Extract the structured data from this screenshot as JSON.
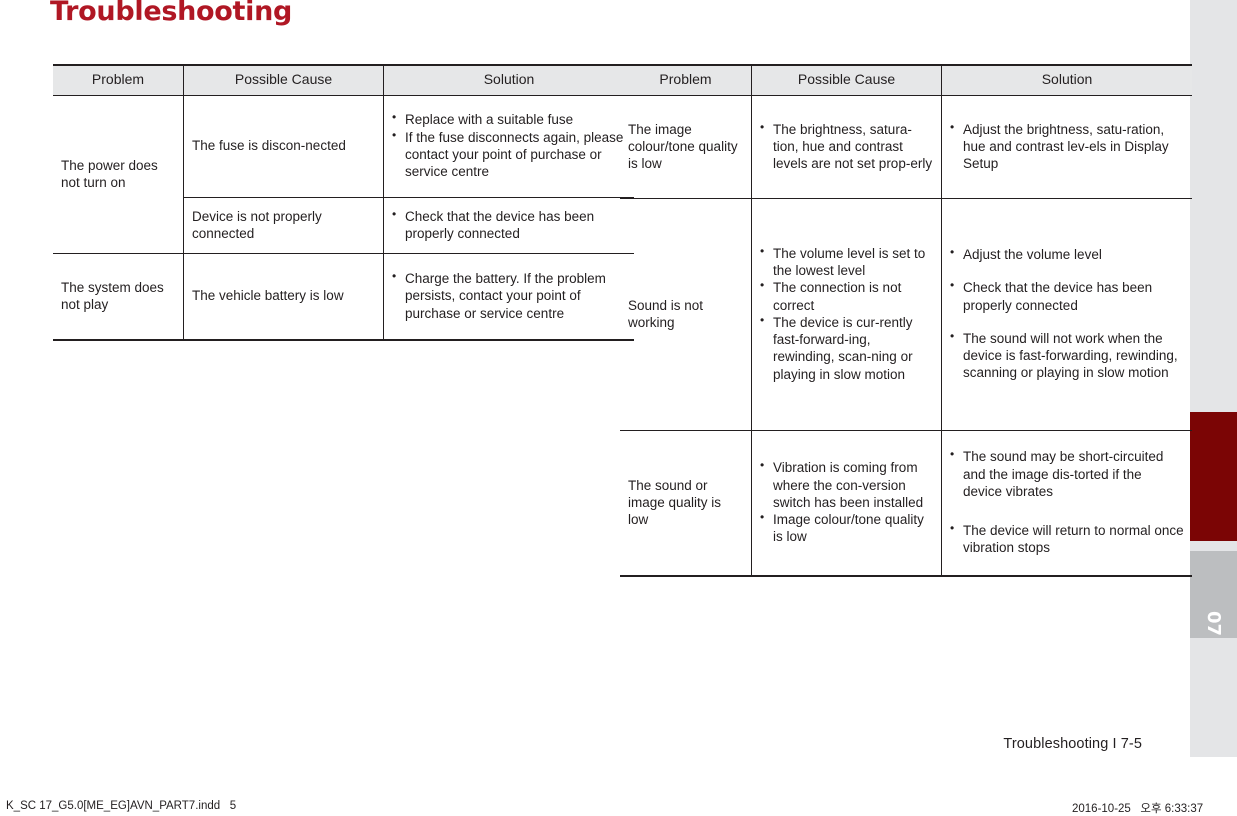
{
  "page": {
    "title": "Troubleshooting",
    "chapter_footer": "Troubleshooting I 7-5",
    "tab_number": "07"
  },
  "tables": {
    "left": {
      "headers": [
        "Problem",
        "Possible Cause",
        "Solution"
      ],
      "rows": [
        {
          "problem": "The power does not turn on",
          "subrows": [
            {
              "cause_text": "The fuse is discon-nected",
              "cause_bullets": [],
              "solution_bullets": [
                "Replace with a suitable fuse",
                "If the fuse disconnects again, please contact your point of purchase or service centre"
              ]
            },
            {
              "cause_text": "Device is not properly connected",
              "cause_bullets": [],
              "solution_bullets": [
                "Check that the device has been properly connected"
              ]
            }
          ]
        },
        {
          "problem": "The system does not play",
          "subrows": [
            {
              "cause_text": "The vehicle battery is low",
              "cause_bullets": [],
              "solution_bullets": [
                "Charge the battery. If the problem persists, contact your point of purchase or service centre"
              ]
            }
          ]
        }
      ]
    },
    "right": {
      "headers": [
        "Problem",
        "Possible Cause",
        "Solution"
      ],
      "rows": [
        {
          "problem": "The image colour/tone quality is low",
          "cause_bullets": [
            "The brightness, satura-tion, hue and contrast levels are not set prop-erly"
          ],
          "solution_bullets": [
            "Adjust the brightness, satu-ration, hue and contrast lev-els in Display Setup"
          ]
        },
        {
          "problem": "Sound is not working",
          "cause_bullets": [
            "The volume level is set to the lowest level",
            "The connection is not correct",
            "The device is cur-rently fast-forward-ing, rewinding, scan-ning or playing in slow motion"
          ],
          "solution_bullets": [
            "Adjust the volume level",
            "Check that the device has been properly connected",
            "The sound will not work when the device is fast-forwarding, rewinding, scanning or playing in slow motion"
          ]
        },
        {
          "problem": "The sound or image quality is low",
          "cause_bullets": [
            "Vibration is coming from where the con-version switch has been installed",
            "Image colour/tone quality is low"
          ],
          "solution_bullets": [
            "The sound may be short-circuited and the image dis-torted if the device vibrates",
            "The device will return to normal once vibration stops"
          ]
        }
      ]
    }
  },
  "print_footer": {
    "file": "K_SC 17_G5.0[ME_EG]AVN_PART7.indd   5",
    "timestamp": "2016-10-25   오후 6:33:37"
  }
}
